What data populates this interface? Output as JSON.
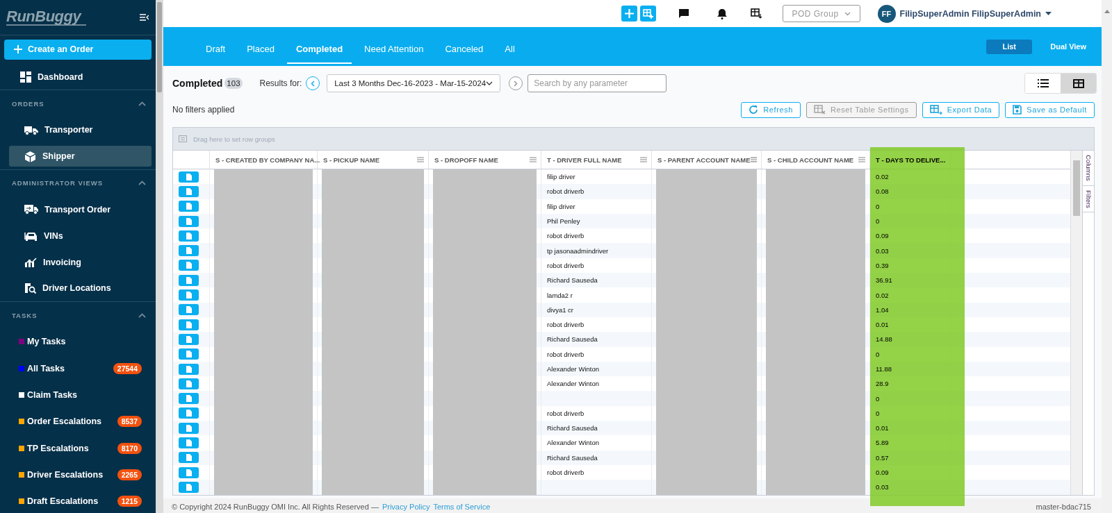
{
  "sidebar": {
    "logo": "RunBuggy",
    "create_button": "Create an Order",
    "top_items": [
      {
        "label": "Dashboard",
        "selected": false
      }
    ],
    "sections": [
      {
        "title": "ORDERS",
        "expanded": true,
        "items": [
          {
            "label": "Transporter",
            "selected": false
          },
          {
            "label": "Shipper",
            "selected": true
          }
        ]
      },
      {
        "title": "ADMINISTRATOR VIEWS",
        "expanded": true,
        "items": [
          {
            "label": "Transport Order",
            "selected": false
          },
          {
            "label": "VINs",
            "selected": false
          },
          {
            "label": "Invoicing",
            "selected": false
          },
          {
            "label": "Driver Locations",
            "selected": false
          }
        ]
      },
      {
        "title": "TASKS",
        "expanded": true,
        "tasks": [
          {
            "label": "My Tasks",
            "color": "#800080"
          },
          {
            "label": "All Tasks",
            "color": "#0000ff",
            "count": "27544"
          },
          {
            "label": "Claim Tasks",
            "color": "#ffffff"
          },
          {
            "label": "Order Escalations",
            "color": "#ffa500",
            "count": "8537"
          },
          {
            "label": "TP Escalations",
            "color": "#ffa500",
            "count": "8170"
          },
          {
            "label": "Driver Escalations",
            "color": "#ffa500",
            "count": "2265"
          },
          {
            "label": "Draft Escalations",
            "color": "#ffa500",
            "count": "1215"
          }
        ]
      }
    ]
  },
  "top_bar": {
    "pod_group": "POD Group",
    "avatar": "FF",
    "user_name": "FilipSuperAdmin FilipSuperAdmin"
  },
  "tabs": [
    {
      "label": "Draft",
      "selected": false
    },
    {
      "label": "Placed",
      "selected": false
    },
    {
      "label": "Completed",
      "selected": true
    },
    {
      "label": "Need Attention",
      "selected": false
    },
    {
      "label": "Canceled",
      "selected": false
    },
    {
      "label": "All",
      "selected": false
    }
  ],
  "view_toggle": [
    {
      "label": "List",
      "selected": true
    },
    {
      "label": "Dual View",
      "selected": false
    }
  ],
  "toolbar": {
    "title": "Completed",
    "count": "103",
    "results_label": "Results for:",
    "date_range": "Last 3 Months Dec-16-2023 - Mar-15-2024",
    "search_placeholder": "Search by any parameter",
    "layout_toggle": [
      {
        "selected": false
      },
      {
        "selected": true
      }
    ],
    "filters_text": "No filters applied",
    "actions": [
      {
        "label": "Refresh",
        "disabled": false
      },
      {
        "label": "Reset Table Settings",
        "disabled": true
      },
      {
        "label": "Export Data",
        "disabled": false
      },
      {
        "label": "Save as Default",
        "disabled": false
      }
    ]
  },
  "table": {
    "group_bar": "Drag here to set row groups",
    "side_tabs": [
      "Columns",
      "Filters"
    ],
    "columns": [
      {
        "label": "S - CREATED BY COMPANY NA...",
        "redacted": true,
        "highlighted": false
      },
      {
        "label": "S - PICKUP NAME",
        "redacted": true,
        "highlighted": false
      },
      {
        "label": "S - DROPOFF NAME",
        "redacted": true,
        "highlighted": false
      },
      {
        "label": "T - DRIVER FULL NAME",
        "redacted": false,
        "highlighted": false
      },
      {
        "label": "S - PARENT ACCOUNT NAME",
        "redacted": true,
        "highlighted": false
      },
      {
        "label": "S - CHILD ACCOUNT NAME",
        "redacted": true,
        "highlighted": false
      },
      {
        "label": "T - DAYS TO DELIVE...",
        "redacted": false,
        "highlighted": true
      }
    ],
    "rows": [
      {
        "driver": "filip driver",
        "days": "0.02"
      },
      {
        "driver": "robot driverb",
        "days": "0.08"
      },
      {
        "driver": "filip driver",
        "days": "0"
      },
      {
        "driver": "Phil Penley",
        "days": "0"
      },
      {
        "driver": "robot driverb",
        "days": "0.09"
      },
      {
        "driver": "tp jasonaadmindriver",
        "days": "0.03"
      },
      {
        "driver": "robot driverb",
        "days": "0.39"
      },
      {
        "driver": "Richard Sauseda",
        "days": "36.91"
      },
      {
        "driver": "lamda2 r",
        "days": "0.02"
      },
      {
        "driver": "divya1 cr",
        "days": "1.04"
      },
      {
        "driver": "robot driverb",
        "days": "0.01"
      },
      {
        "driver": "Richard Sauseda",
        "days": "14.88"
      },
      {
        "driver": "robot driverb",
        "days": "0"
      },
      {
        "driver": "Alexander Winton",
        "days": "11.88"
      },
      {
        "driver": "Alexander Winton",
        "days": "28.9"
      },
      {
        "days": "0"
      },
      {
        "driver": "robot driverb",
        "days": "0"
      },
      {
        "driver": "Richard Sauseda",
        "days": "0.01"
      },
      {
        "driver": "Alexander Winton",
        "days": "5.89"
      },
      {
        "driver": "Richard Sauseda",
        "days": "0.57"
      },
      {
        "driver": "robot driverb",
        "days": "0.09"
      },
      {
        "days": "0.03"
      }
    ]
  },
  "footer": {
    "copyright": "© Copyright 2024 RunBuggy OMI Inc. All Rights Reserved —",
    "links": [
      "Privacy Policy",
      "Terms of Service"
    ],
    "version": "master-bdac715"
  }
}
